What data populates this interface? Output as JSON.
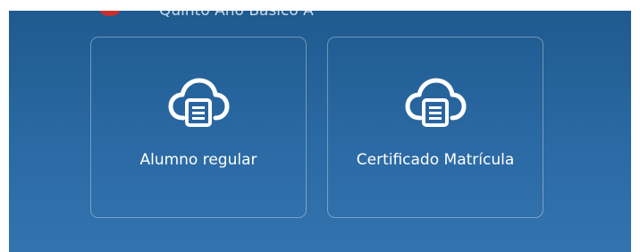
{
  "header": {
    "class_label": "Quinto Año Básico A",
    "avatar_color": "#c9302c"
  },
  "cards": [
    {
      "label": "Alumno regular",
      "icon": "cloud-print-icon"
    },
    {
      "label": "Certificado Matrícula",
      "icon": "cloud-print-icon"
    }
  ],
  "colors": {
    "panel_top": "#1f5a8f",
    "panel_bottom": "#3274b0",
    "text": "#ffffff"
  }
}
